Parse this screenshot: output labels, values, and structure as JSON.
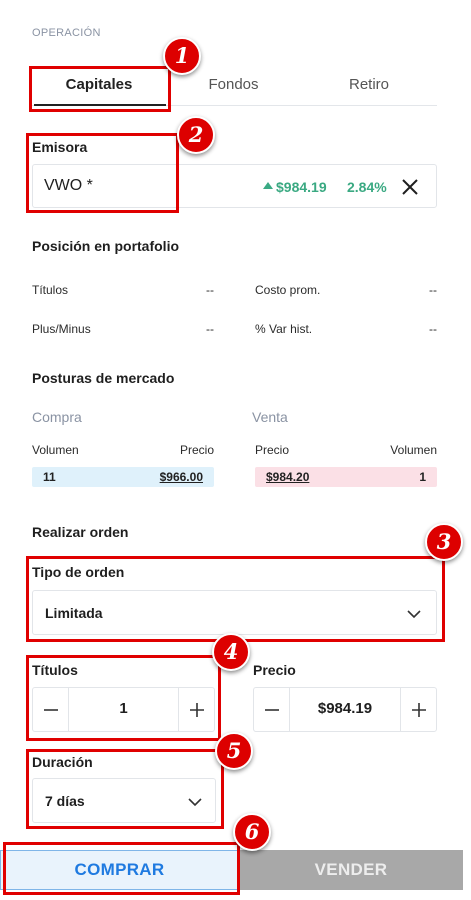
{
  "section_label": "OPERACIÓN",
  "tabs": [
    {
      "label": "Capitales",
      "active": true
    },
    {
      "label": "Fondos",
      "active": false
    },
    {
      "label": "Retiro",
      "active": false
    }
  ],
  "emisora": {
    "label": "Emisora",
    "value": "VWO *",
    "price": "$984.19",
    "change": "2.84%",
    "trend_icon": "up-arrow-icon",
    "positive_color": "#3aa982"
  },
  "position": {
    "title": "Posición en portafolio",
    "titulos_label": "Títulos",
    "titulos_value": "--",
    "costo_label": "Costo prom.",
    "costo_value": "--",
    "plus_label": "Plus/Minus",
    "plus_value": "--",
    "var_label": "% Var hist.",
    "var_value": "--"
  },
  "market": {
    "title": "Posturas de mercado",
    "buy": {
      "title": "Compra",
      "col1": "Volumen",
      "col2": "Precio",
      "volume": "11",
      "price": "$966.00"
    },
    "sell": {
      "title": "Venta",
      "col1": "Precio",
      "col2": "Volumen",
      "price": "$984.20",
      "volume": "1"
    }
  },
  "order": {
    "title": "Realizar orden",
    "type_label": "Tipo de orden",
    "type_value": "Limitada",
    "titulos_label": "Títulos",
    "titulos_value": "1",
    "precio_label": "Precio",
    "precio_value": "$984.19",
    "duracion_label": "Duración",
    "duracion_value": "7 días"
  },
  "actions": {
    "buy": "COMPRAR",
    "sell": "VENDER"
  },
  "annotations": [
    "1",
    "2",
    "3",
    "4",
    "5",
    "6"
  ],
  "colors": {
    "accent_blue": "#1f7ae0",
    "annotation_red": "#e00000",
    "buy_row_bg": "#dff1fb",
    "sell_row_bg": "#fbe0e6"
  }
}
